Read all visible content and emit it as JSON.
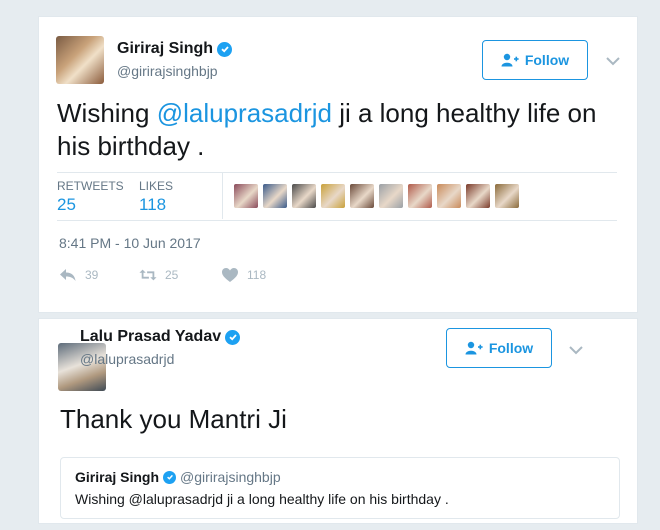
{
  "tweet1": {
    "author_name": "Giriraj Singh",
    "author_handle": "@girirajsinghbjp",
    "follow_label": "Follow",
    "text_prefix": "Wishing ",
    "mention": "@laluprasadrjd",
    "text_suffix": " ji a long healthy life on his birthday .",
    "retweets_label": "RETWEETS",
    "retweets_count": "25",
    "likes_label": "LIKES",
    "likes_count": "118",
    "timestamp": "8:41 PM - 10 Jun 2017",
    "actions": {
      "reply_count": "39",
      "retweet_count": "25",
      "like_count": "118"
    },
    "liker_avatar_colors": [
      "#8a4a5a",
      "#3a5a8a",
      "#4a4a4a",
      "#c9a13a",
      "#6a4a3a",
      "#9aa0a6",
      "#b05a4a",
      "#c98a5a",
      "#7a3a2a",
      "#8a6a3a"
    ]
  },
  "tweet2": {
    "author_name": "Lalu Prasad Yadav",
    "author_handle": "@laluprasadrjd",
    "follow_label": "Follow",
    "text": "Thank you Mantri Ji",
    "quote": {
      "author_name": "Giriraj Singh",
      "author_handle": "@girirajsinghbjp",
      "text": "Wishing @laluprasadrjd ji a long healthy life on his birthday ."
    }
  },
  "colors": {
    "accent": "#1b95e0",
    "verified": "#1da1f2",
    "muted": "#657786",
    "icon_muted": "#aab8c2"
  },
  "icons": {
    "verified": "verified-badge-icon",
    "follow": "add-person-icon",
    "chevron": "chevron-down-icon",
    "reply": "reply-icon",
    "retweet": "retweet-icon",
    "like": "heart-icon"
  }
}
